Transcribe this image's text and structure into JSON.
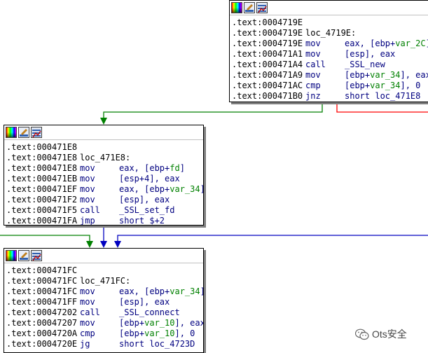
{
  "graph": {
    "nodes": [
      {
        "id": "node-4719e",
        "lines": [
          {
            "addr": ".text:0004719E",
            "label": "",
            "mnem": "",
            "ops": []
          },
          {
            "addr": ".text:0004719E",
            "label": "loc_4719E:",
            "mnem": "",
            "ops": []
          },
          {
            "addr": ".text:0004719E",
            "label": "",
            "mnem": "mov",
            "ops": [
              {
                "t": "eax, [ebp+",
                "c": "op"
              },
              {
                "t": "var_2C",
                "c": "var"
              },
              {
                "t": "]",
                "c": "op"
              }
            ]
          },
          {
            "addr": ".text:000471A1",
            "label": "",
            "mnem": "mov",
            "ops": [
              {
                "t": "[esp], eax",
                "c": "op"
              }
            ]
          },
          {
            "addr": ".text:000471A4",
            "label": "",
            "mnem": "call",
            "ops": [
              {
                "t": "_SSL_new",
                "c": "op"
              }
            ]
          },
          {
            "addr": ".text:000471A9",
            "label": "",
            "mnem": "mov",
            "ops": [
              {
                "t": "[ebp+",
                "c": "op"
              },
              {
                "t": "var_34",
                "c": "var"
              },
              {
                "t": "], eax",
                "c": "op"
              }
            ]
          },
          {
            "addr": ".text:000471AC",
            "label": "",
            "mnem": "cmp",
            "ops": [
              {
                "t": "[ebp+",
                "c": "op"
              },
              {
                "t": "var_34",
                "c": "var"
              },
              {
                "t": "], 0",
                "c": "op"
              }
            ]
          },
          {
            "addr": ".text:000471B0",
            "label": "",
            "mnem": "jnz",
            "ops": [
              {
                "t": "short loc_471E8",
                "c": "op"
              }
            ]
          }
        ]
      },
      {
        "id": "node-471e8",
        "lines": [
          {
            "addr": ".text:000471E8",
            "label": "",
            "mnem": "",
            "ops": []
          },
          {
            "addr": ".text:000471E8",
            "label": "loc_471E8:",
            "mnem": "",
            "ops": []
          },
          {
            "addr": ".text:000471E8",
            "label": "",
            "mnem": "mov",
            "ops": [
              {
                "t": "eax, [ebp+",
                "c": "op"
              },
              {
                "t": "fd",
                "c": "var"
              },
              {
                "t": "]",
                "c": "op"
              }
            ]
          },
          {
            "addr": ".text:000471EB",
            "label": "",
            "mnem": "mov",
            "ops": [
              {
                "t": "[esp+4], eax",
                "c": "op"
              }
            ]
          },
          {
            "addr": ".text:000471EF",
            "label": "",
            "mnem": "mov",
            "ops": [
              {
                "t": "eax, [ebp+",
                "c": "op"
              },
              {
                "t": "var_34",
                "c": "var"
              },
              {
                "t": "]",
                "c": "op"
              }
            ]
          },
          {
            "addr": ".text:000471F2",
            "label": "",
            "mnem": "mov",
            "ops": [
              {
                "t": "[esp], eax",
                "c": "op"
              }
            ]
          },
          {
            "addr": ".text:000471F5",
            "label": "",
            "mnem": "call",
            "ops": [
              {
                "t": "_SSL_set_fd",
                "c": "op"
              }
            ]
          },
          {
            "addr": ".text:000471FA",
            "label": "",
            "mnem": "jmp",
            "ops": [
              {
                "t": "short $+2",
                "c": "op"
              }
            ]
          }
        ]
      },
      {
        "id": "node-471fc",
        "lines": [
          {
            "addr": ".text:000471FC",
            "label": "",
            "mnem": "",
            "ops": []
          },
          {
            "addr": ".text:000471FC",
            "label": "loc_471FC:",
            "mnem": "",
            "ops": []
          },
          {
            "addr": ".text:000471FC",
            "label": "",
            "mnem": "mov",
            "ops": [
              {
                "t": "eax, [ebp+",
                "c": "op"
              },
              {
                "t": "var_34",
                "c": "var"
              },
              {
                "t": "]",
                "c": "op"
              }
            ]
          },
          {
            "addr": ".text:000471FF",
            "label": "",
            "mnem": "mov",
            "ops": [
              {
                "t": "[esp], eax",
                "c": "op"
              }
            ]
          },
          {
            "addr": ".text:00047202",
            "label": "",
            "mnem": "call",
            "ops": [
              {
                "t": "_SSL_connect",
                "c": "op"
              }
            ]
          },
          {
            "addr": ".text:00047207",
            "label": "",
            "mnem": "mov",
            "ops": [
              {
                "t": "[ebp+",
                "c": "op"
              },
              {
                "t": "var_10",
                "c": "var"
              },
              {
                "t": "], eax",
                "c": "op"
              }
            ]
          },
          {
            "addr": ".text:0004720A",
            "label": "",
            "mnem": "cmp",
            "ops": [
              {
                "t": "[ebp+",
                "c": "op"
              },
              {
                "t": "var_10",
                "c": "var"
              },
              {
                "t": "], 0",
                "c": "op"
              }
            ]
          },
          {
            "addr": ".text:0004720E",
            "label": "",
            "mnem": "jg",
            "ops": [
              {
                "t": "short loc_4723D",
                "c": "op"
              }
            ]
          }
        ]
      }
    ],
    "toolbar_icons": [
      "color-palette-icon",
      "rename-icon",
      "graph-icon"
    ],
    "edge_colors": {
      "true_branch": "#008000",
      "false_branch": "#ff0000",
      "unconditional": "#0000c0"
    }
  },
  "watermark": {
    "text": "Ots安全",
    "icon": "wechat-icon"
  }
}
